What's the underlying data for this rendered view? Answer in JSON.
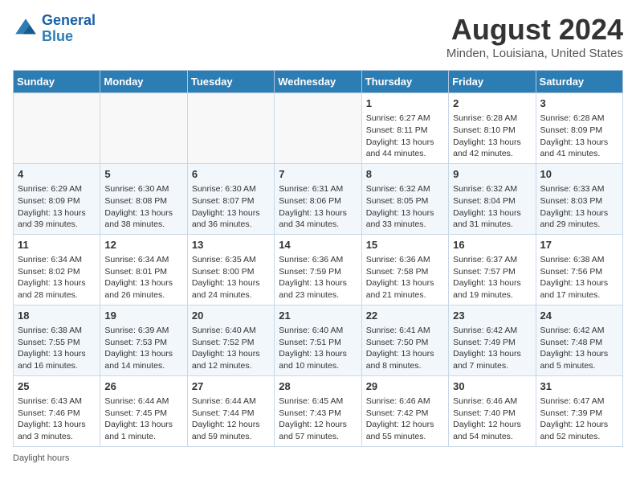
{
  "logo": {
    "line1": "General",
    "line2": "Blue"
  },
  "title": "August 2024",
  "subtitle": "Minden, Louisiana, United States",
  "days_of_week": [
    "Sunday",
    "Monday",
    "Tuesday",
    "Wednesday",
    "Thursday",
    "Friday",
    "Saturday"
  ],
  "footer_label": "Daylight hours",
  "weeks": [
    [
      {
        "day": "",
        "info": ""
      },
      {
        "day": "",
        "info": ""
      },
      {
        "day": "",
        "info": ""
      },
      {
        "day": "",
        "info": ""
      },
      {
        "day": "1",
        "info": "Sunrise: 6:27 AM\nSunset: 8:11 PM\nDaylight: 13 hours\nand 44 minutes."
      },
      {
        "day": "2",
        "info": "Sunrise: 6:28 AM\nSunset: 8:10 PM\nDaylight: 13 hours\nand 42 minutes."
      },
      {
        "day": "3",
        "info": "Sunrise: 6:28 AM\nSunset: 8:09 PM\nDaylight: 13 hours\nand 41 minutes."
      }
    ],
    [
      {
        "day": "4",
        "info": "Sunrise: 6:29 AM\nSunset: 8:09 PM\nDaylight: 13 hours\nand 39 minutes."
      },
      {
        "day": "5",
        "info": "Sunrise: 6:30 AM\nSunset: 8:08 PM\nDaylight: 13 hours\nand 38 minutes."
      },
      {
        "day": "6",
        "info": "Sunrise: 6:30 AM\nSunset: 8:07 PM\nDaylight: 13 hours\nand 36 minutes."
      },
      {
        "day": "7",
        "info": "Sunrise: 6:31 AM\nSunset: 8:06 PM\nDaylight: 13 hours\nand 34 minutes."
      },
      {
        "day": "8",
        "info": "Sunrise: 6:32 AM\nSunset: 8:05 PM\nDaylight: 13 hours\nand 33 minutes."
      },
      {
        "day": "9",
        "info": "Sunrise: 6:32 AM\nSunset: 8:04 PM\nDaylight: 13 hours\nand 31 minutes."
      },
      {
        "day": "10",
        "info": "Sunrise: 6:33 AM\nSunset: 8:03 PM\nDaylight: 13 hours\nand 29 minutes."
      }
    ],
    [
      {
        "day": "11",
        "info": "Sunrise: 6:34 AM\nSunset: 8:02 PM\nDaylight: 13 hours\nand 28 minutes."
      },
      {
        "day": "12",
        "info": "Sunrise: 6:34 AM\nSunset: 8:01 PM\nDaylight: 13 hours\nand 26 minutes."
      },
      {
        "day": "13",
        "info": "Sunrise: 6:35 AM\nSunset: 8:00 PM\nDaylight: 13 hours\nand 24 minutes."
      },
      {
        "day": "14",
        "info": "Sunrise: 6:36 AM\nSunset: 7:59 PM\nDaylight: 13 hours\nand 23 minutes."
      },
      {
        "day": "15",
        "info": "Sunrise: 6:36 AM\nSunset: 7:58 PM\nDaylight: 13 hours\nand 21 minutes."
      },
      {
        "day": "16",
        "info": "Sunrise: 6:37 AM\nSunset: 7:57 PM\nDaylight: 13 hours\nand 19 minutes."
      },
      {
        "day": "17",
        "info": "Sunrise: 6:38 AM\nSunset: 7:56 PM\nDaylight: 13 hours\nand 17 minutes."
      }
    ],
    [
      {
        "day": "18",
        "info": "Sunrise: 6:38 AM\nSunset: 7:55 PM\nDaylight: 13 hours\nand 16 minutes."
      },
      {
        "day": "19",
        "info": "Sunrise: 6:39 AM\nSunset: 7:53 PM\nDaylight: 13 hours\nand 14 minutes."
      },
      {
        "day": "20",
        "info": "Sunrise: 6:40 AM\nSunset: 7:52 PM\nDaylight: 13 hours\nand 12 minutes."
      },
      {
        "day": "21",
        "info": "Sunrise: 6:40 AM\nSunset: 7:51 PM\nDaylight: 13 hours\nand 10 minutes."
      },
      {
        "day": "22",
        "info": "Sunrise: 6:41 AM\nSunset: 7:50 PM\nDaylight: 13 hours\nand 8 minutes."
      },
      {
        "day": "23",
        "info": "Sunrise: 6:42 AM\nSunset: 7:49 PM\nDaylight: 13 hours\nand 7 minutes."
      },
      {
        "day": "24",
        "info": "Sunrise: 6:42 AM\nSunset: 7:48 PM\nDaylight: 13 hours\nand 5 minutes."
      }
    ],
    [
      {
        "day": "25",
        "info": "Sunrise: 6:43 AM\nSunset: 7:46 PM\nDaylight: 13 hours\nand 3 minutes."
      },
      {
        "day": "26",
        "info": "Sunrise: 6:44 AM\nSunset: 7:45 PM\nDaylight: 13 hours\nand 1 minute."
      },
      {
        "day": "27",
        "info": "Sunrise: 6:44 AM\nSunset: 7:44 PM\nDaylight: 12 hours\nand 59 minutes."
      },
      {
        "day": "28",
        "info": "Sunrise: 6:45 AM\nSunset: 7:43 PM\nDaylight: 12 hours\nand 57 minutes."
      },
      {
        "day": "29",
        "info": "Sunrise: 6:46 AM\nSunset: 7:42 PM\nDaylight: 12 hours\nand 55 minutes."
      },
      {
        "day": "30",
        "info": "Sunrise: 6:46 AM\nSunset: 7:40 PM\nDaylight: 12 hours\nand 54 minutes."
      },
      {
        "day": "31",
        "info": "Sunrise: 6:47 AM\nSunset: 7:39 PM\nDaylight: 12 hours\nand 52 minutes."
      }
    ]
  ]
}
